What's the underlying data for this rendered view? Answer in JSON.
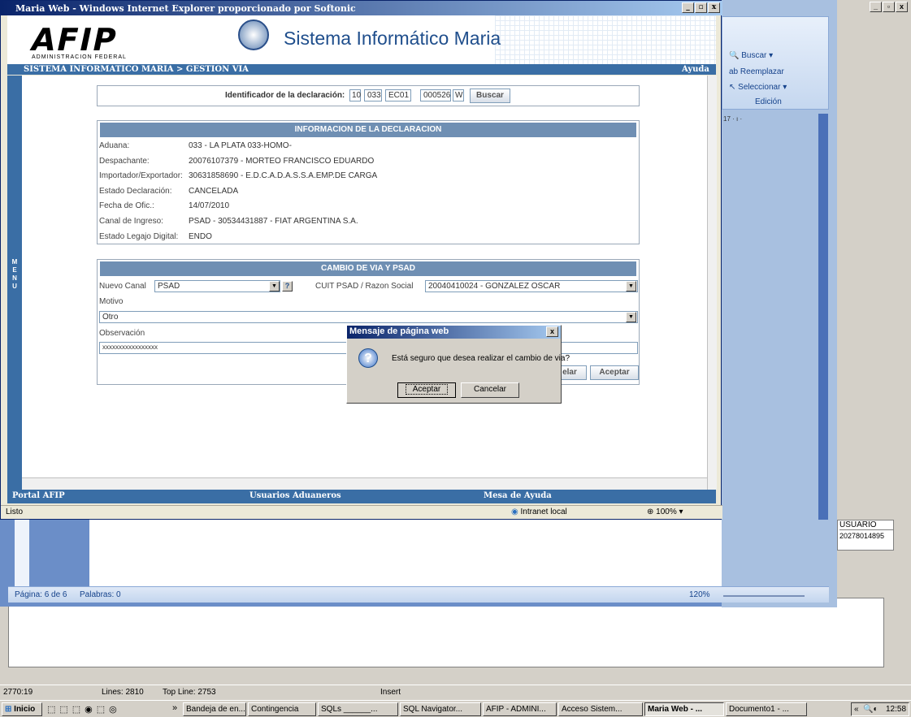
{
  "ie": {
    "title": "Maria Web - Windows Internet Explorer proporcionado por Softonic",
    "banner_sub": "ADMINISTRACION FEDERAL",
    "banner_logo": "AFIP",
    "banner_title": "Sistema Informático Maria",
    "breadcrumb": "SISTEMA INFORMATICO MARIA > GESTION VIA",
    "help": "Ayuda",
    "menu_label": "MENU",
    "status_left": "Listo",
    "status_zone": "Intranet local",
    "status_zoom": "100%",
    "footer": {
      "portal": "Portal AFIP",
      "usuarios": "Usuarios Aduaneros",
      "mesa": "Mesa de Ayuda"
    }
  },
  "form": {
    "id_label": "Identificador de la declaración:",
    "id_parts": [
      "10",
      "033",
      "EC01",
      "000526",
      "W"
    ],
    "search_btn": "Buscar",
    "info_header": "INFORMACION DE LA DECLARACION",
    "info_rows": [
      {
        "label": "Aduana:",
        "value": "033 - LA PLATA 033-HOMO-"
      },
      {
        "label": "Despachante:",
        "value": "20076107379 - MORTEO FRANCISCO EDUARDO"
      },
      {
        "label": "Importador/Exportador:",
        "value": "30631858690 - E.D.C.A.D.A.S.S.A.EMP.DE CARGA"
      },
      {
        "label": "Estado Declaración:",
        "value": "CANCELADA"
      },
      {
        "label": "Fecha de Ofic.:",
        "value": "14/07/2010"
      },
      {
        "label": "Canal de Ingreso:",
        "value": "PSAD - 30534431887 - FIAT ARGENTINA S.A."
      },
      {
        "label": "Estado Legajo Digital:",
        "value": "ENDO"
      }
    ],
    "change_header": "CAMBIO DE VIA Y PSAD",
    "nuevo_canal_label": "Nuevo Canal",
    "nuevo_canal_value": "PSAD",
    "help_q": "?",
    "cuit_label": "CUIT PSAD / Razon Social",
    "cuit_value": "20040410024 - GONZALEZ OSCAR",
    "motivo_label": "Motivo",
    "motivo_value": "Otro",
    "obs_label": "Observación",
    "obs_value": "xxxxxxxxxxxxxxxxx",
    "cancel_btn_partial": "elar",
    "accept_btn": "Aceptar"
  },
  "dialog": {
    "title": "Mensaje de página web",
    "message": "Está seguro que desea realizar el cambio de via?",
    "ok": "Aceptar",
    "cancel": "Cancelar",
    "close": "x",
    "question_glyph": "?"
  },
  "word": {
    "buscar": "Buscar",
    "reemplazar": "Reemplazar",
    "seleccionar": "Seleccionar",
    "edicion": "Edición",
    "page_status": "Página: 6 de 6",
    "words_status": "Palabras: 0",
    "zoom": "120%",
    "ruler_marks": "17 · ı ·"
  },
  "sqlnav": {
    "usuario_header": "USUARIO",
    "usuario_value": "20278014895",
    "pos": "2770:19",
    "lines": "Lines: 2810",
    "topline": "Top Line: 2753",
    "mode": "Insert"
  },
  "taskbar": {
    "start": "Inicio",
    "chevron": "»",
    "items": [
      {
        "label": "Bandeja de en...",
        "active": false
      },
      {
        "label": "Contingencia",
        "active": false
      },
      {
        "label": "SQLs ______...",
        "active": false
      },
      {
        "label": "SQL Navigator...",
        "active": false
      },
      {
        "label": "AFIP - ADMINI...",
        "active": false
      },
      {
        "label": "Acceso Sistem...",
        "active": false
      },
      {
        "label": "Maria Web - ...",
        "active": true
      },
      {
        "label": "Documento1 - ...",
        "active": false
      }
    ],
    "tray_chevron": "«",
    "clock": "12:58"
  }
}
